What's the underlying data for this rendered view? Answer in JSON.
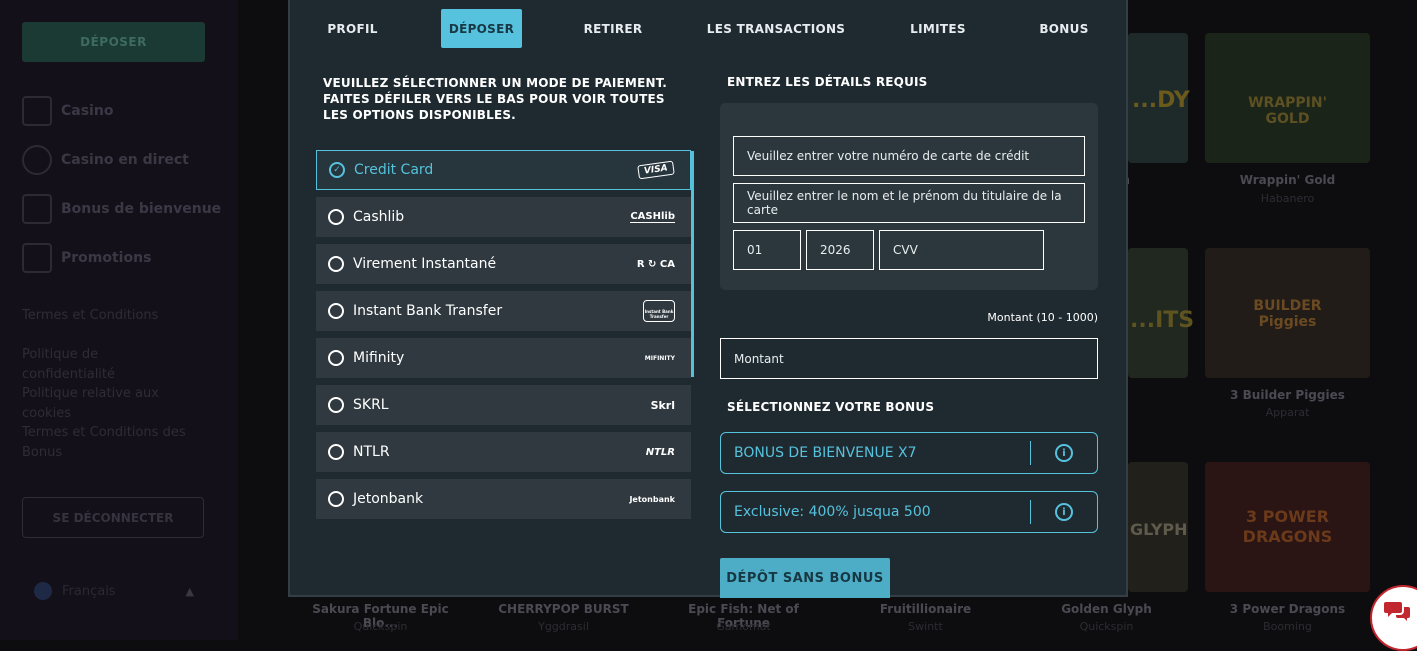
{
  "sidebar": {
    "deposit_label": "DÉPOSER",
    "nav": [
      {
        "label": "Casino",
        "icon": "casino-icon"
      },
      {
        "label": "Casino en direct",
        "icon": "live-casino-icon"
      },
      {
        "label": "Bonus de bienvenue",
        "icon": "gift-icon"
      },
      {
        "label": "Promotions",
        "icon": "promotions-icon"
      }
    ],
    "links": [
      "Termes et Conditions",
      "Politique de confidentialité",
      "Politique relative aux cookies",
      "Termes et Conditions des Bonus"
    ],
    "logout_label": "SE DÉCONNECTER",
    "language": "Français"
  },
  "games": {
    "top": [
      {
        "name": "...pin",
        "provider": "...",
        "art": "...DY"
      },
      {
        "name": "Wrappin' Gold",
        "provider": "Habanero",
        "art": "WRAPPIN' GOLD"
      }
    ],
    "middle": [
      {
        "name": "",
        "provider": "",
        "art": "...ITS"
      },
      {
        "name": "3 Builder Piggies",
        "provider": "Apparat",
        "art": "BUILDER Piggies"
      }
    ],
    "bottom": [
      {
        "name": "Sakura Fortune Epic Blo...",
        "provider": "Quickspin"
      },
      {
        "name": "CHERRYPOP BURST",
        "provider": "Yggdrasil"
      },
      {
        "name": "Epic Fish: Net of Fortune",
        "provider": "Gamomat"
      },
      {
        "name": "Fruitillionaire",
        "provider": "Swintt"
      },
      {
        "name": "Golden Glyph",
        "provider": "Quickspin",
        "art": "GLYPH"
      },
      {
        "name": "3 Power Dragons",
        "provider": "Booming",
        "art": "3 POWER DRAGONS"
      }
    ]
  },
  "modal": {
    "tabs": [
      {
        "label": "PROFIL",
        "active": false
      },
      {
        "label": "DÉPOSER",
        "active": true
      },
      {
        "label": "RETIRER",
        "active": false
      },
      {
        "label": "LES TRANSACTIONS",
        "active": false
      },
      {
        "label": "LIMITES",
        "active": false
      },
      {
        "label": "BONUS",
        "active": false
      }
    ],
    "left_title": "VEUILLEZ SÉLECTIONNER UN MODE DE PAIEMENT. FAITES DÉFILER VERS LE BAS POUR VOIR TOUTES LES OPTIONS DISPONIBLES.",
    "right_title": "ENTREZ LES DÉTAILS REQUIS",
    "payment_methods": [
      {
        "label": "Credit Card",
        "logo": "VISA",
        "selected": true
      },
      {
        "label": "Cashlib",
        "logo": "CASHlib",
        "selected": false
      },
      {
        "label": "Virement Instantané",
        "logo": "R ↻ CA",
        "selected": false
      },
      {
        "label": "Instant Bank Transfer",
        "logo": "Instant Bank Transfer",
        "selected": false
      },
      {
        "label": "Mifinity",
        "logo": "MIFINITY",
        "selected": false
      },
      {
        "label": "SKRL",
        "logo": "Skrl",
        "selected": false
      },
      {
        "label": "NTLR",
        "logo": "NTLR",
        "selected": false
      },
      {
        "label": "Jetonbank",
        "logo": "Jetonbank",
        "selected": false
      }
    ],
    "form": {
      "card_number_placeholder": "Veuillez entrer votre numéro de carte de crédit",
      "card_holder_placeholder": "Veuillez entrer le nom et le prénom du titulaire de la carte",
      "expiry_month": "01",
      "expiry_year": "2026",
      "cvv_placeholder": "CVV",
      "amount_label": "Montant (10 - 1000)",
      "amount_placeholder": "Montant"
    },
    "bonus_title": "SÉLECTIONNEZ VOTRE BONUS",
    "bonuses": [
      {
        "label": "BONUS DE BIENVENUE X7"
      },
      {
        "label": "Exclusive: 400% jusqua 500"
      }
    ],
    "no_bonus_label": "DÉPÔT SANS BONUS"
  },
  "colors": {
    "accent": "#56c2dd",
    "modal_bg": "#1f2a30",
    "item_bg": "#2f393f",
    "chat_red": "#c2262e"
  }
}
